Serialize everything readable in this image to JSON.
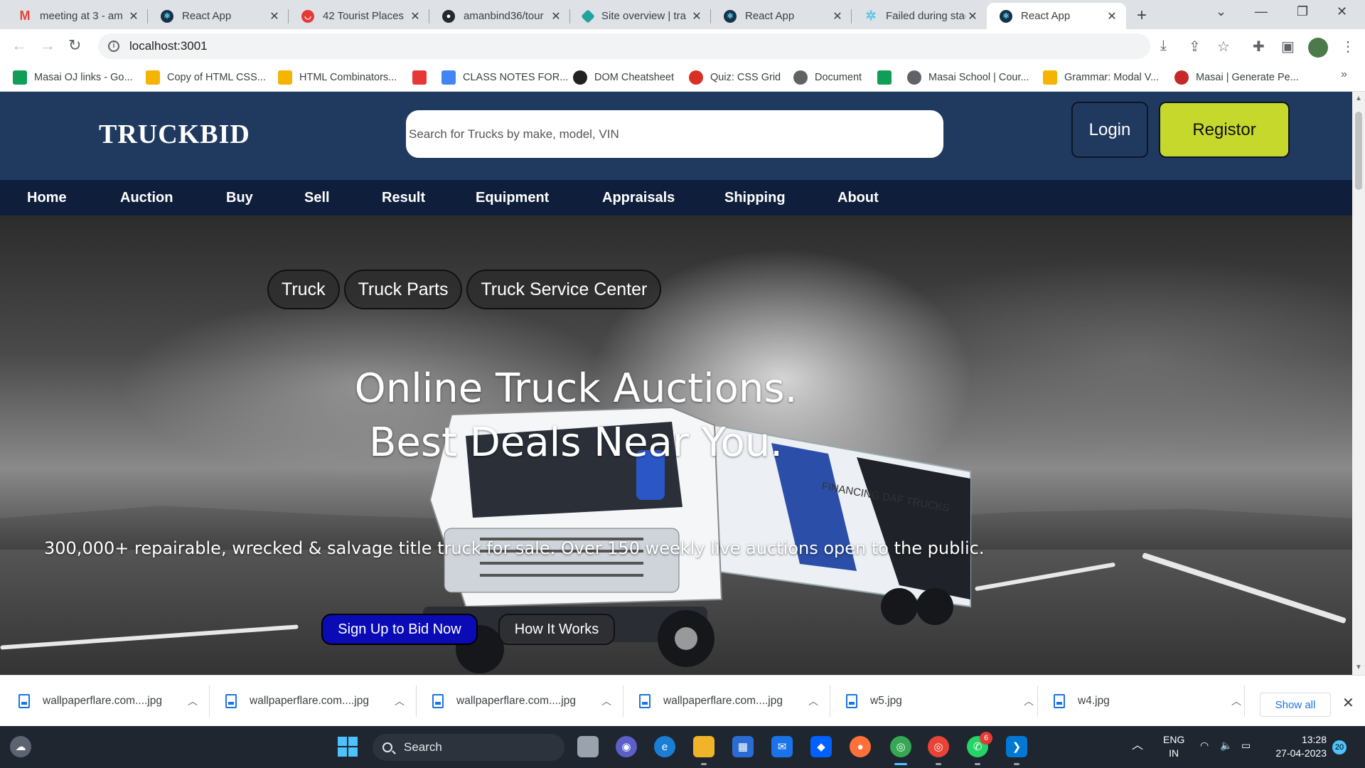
{
  "browser": {
    "tabs": [
      {
        "title": "meeting at 3 - am",
        "icon": "gmail-icon",
        "color": "#ea4335"
      },
      {
        "title": "React App",
        "icon": "react-icon",
        "color": "#0b7285"
      },
      {
        "title": "42 Tourist Places",
        "icon": "site-icon",
        "color": "#e53935"
      },
      {
        "title": "amanbind36/tour",
        "icon": "github-icon",
        "color": "#24292f"
      },
      {
        "title": "Site overview | tra",
        "icon": "netlify-icon",
        "color": "#20a39e"
      },
      {
        "title": "React App",
        "icon": "react-icon",
        "color": "#0b7285"
      },
      {
        "title": "Failed during stag",
        "icon": "netlify-icon",
        "color": "#5ac8e8"
      },
      {
        "title": "React App",
        "icon": "react-icon",
        "color": "#0b7285"
      }
    ],
    "url": "localhost:3001",
    "bookmarks": [
      {
        "label": "Masai OJ links - Go...",
        "color": "#0f9d58"
      },
      {
        "label": "Copy of HTML CSS...",
        "color": "#f4b400"
      },
      {
        "label": "HTML Combinators...",
        "color": "#f4b400"
      },
      {
        "label": "",
        "color": "#e53935"
      },
      {
        "label": "CLASS NOTES FOR...",
        "color": "#4285f4"
      },
      {
        "label": "DOM Cheatsheet",
        "color": "#222222"
      },
      {
        "label": "Quiz: CSS Grid",
        "color": "#d93025"
      },
      {
        "label": "Document",
        "color": "#5f6368"
      },
      {
        "label": "",
        "color": "#0f9d58"
      },
      {
        "label": "Masai School | Cour...",
        "color": "#5f6368"
      },
      {
        "label": "Grammar: Modal V...",
        "color": "#f4b400"
      },
      {
        "label": "Masai | Generate Pe...",
        "color": "#c62828"
      }
    ]
  },
  "site": {
    "brand": "TRUCKBID",
    "search_placeholder": "Search for Trucks by make, model, VIN",
    "login_label": "Login",
    "register_label": "Registor",
    "nav": [
      "Home",
      "Auction",
      "Buy",
      "Sell",
      "Result",
      "Equipment",
      "Appraisals",
      "Shipping",
      "About"
    ],
    "category_tabs": [
      "Truck",
      "Truck Parts",
      "Truck Service Center"
    ],
    "hero_title_line1": "Online Truck Auctions.",
    "hero_title_line2": "Best Deals Near You.",
    "hero_subtitle": "300,000+ repairable, wrecked & salvage title truck for sale. Over 150 weekly live auctions open to the public.",
    "signup_label": "Sign Up to Bid Now",
    "how_label": "How It Works",
    "truck_trailer_text": "FINANCING DAF TRUCKS",
    "colors": {
      "header": "#203a5f",
      "nav": "#0f1f3b",
      "register": "#c7d82c",
      "signup": "#0b0bb5"
    }
  },
  "downloads": {
    "files": [
      "wallpaperflare.com....jpg",
      "wallpaperflare.com....jpg",
      "wallpaperflare.com....jpg",
      "wallpaperflare.com....jpg",
      "w5.jpg",
      "w4.jpg"
    ],
    "show_all": "Show all"
  },
  "taskbar": {
    "search_label": "Search",
    "lang_line1": "ENG",
    "lang_line2": "IN",
    "time": "13:28",
    "date": "27-04-2023",
    "notification_count": "20",
    "whatsapp_badge": "6"
  }
}
